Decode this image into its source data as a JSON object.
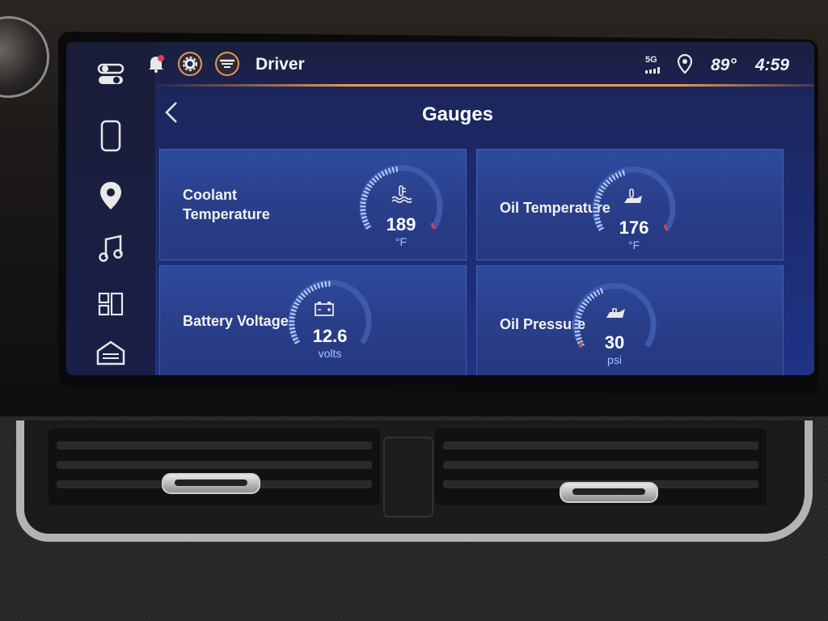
{
  "status_bar": {
    "profile": "Driver",
    "network": "5G",
    "temperature": "89°",
    "time": "4:59"
  },
  "page": {
    "title": "Gauges"
  },
  "sidebar": {
    "items": [
      {
        "name": "toggles-icon"
      },
      {
        "name": "phone-icon"
      },
      {
        "name": "location-pin-icon"
      },
      {
        "name": "music-note-icon"
      },
      {
        "name": "apps-grid-icon"
      },
      {
        "name": "home-icon"
      }
    ]
  },
  "gauges": [
    {
      "label_line1": "Coolant",
      "label_line2": "Temperature",
      "value": "189",
      "unit": "°F",
      "icon": "coolant-thermometer-icon"
    },
    {
      "label_line1": "Oil Temperature",
      "label_line2": "",
      "value": "176",
      "unit": "°F",
      "icon": "oil-can-thermometer-icon"
    },
    {
      "label_line1": "Battery Voltage",
      "label_line2": "",
      "value": "12.6",
      "unit": "volts",
      "icon": "battery-icon"
    },
    {
      "label_line1": "Oil Pressure",
      "label_line2": "",
      "value": "30",
      "unit": "psi",
      "icon": "oil-can-icon"
    }
  ],
  "colors": {
    "accent": "#e69a4d",
    "screen_bg": "#1f3286",
    "card_bg": "#2f4a9e",
    "unit_text": "#9ec4ff",
    "gauge_redline": "#e0404a"
  }
}
